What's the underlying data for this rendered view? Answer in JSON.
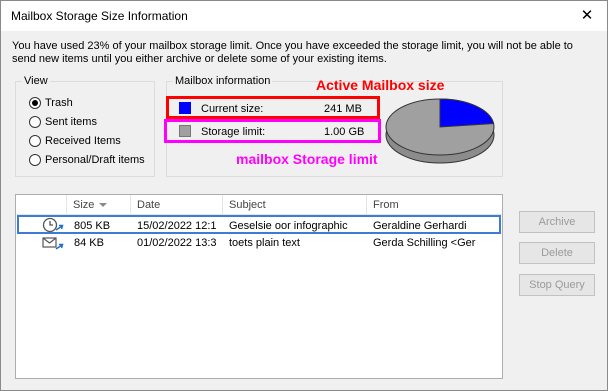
{
  "window": {
    "title": "Mailbox Storage Size Information",
    "close_glyph": "✕"
  },
  "intro_text": "You have used 23% of your mailbox storage limit.  Once you have exceeded the storage limit, you will not be able to send new items until you either archive or delete some of your existing items.",
  "view": {
    "label": "View",
    "options": [
      {
        "label": "Trash",
        "checked": true
      },
      {
        "label": "Sent items",
        "checked": false
      },
      {
        "label": "Received Items",
        "checked": false
      },
      {
        "label": "Personal/Draft items",
        "checked": false
      }
    ]
  },
  "mailbox_info": {
    "label": "Mailbox information",
    "current_size_label": "Current size:",
    "current_size_value": "241 MB",
    "current_size_color": "#0000ff",
    "storage_limit_label": "Storage limit:",
    "storage_limit_value": "1.00 GB",
    "storage_limit_color": "#a0a0a0",
    "used_fraction": 0.23
  },
  "annotations": {
    "active_text": "Active Mailbox size",
    "active_color": "#ff0000",
    "storage_text": "mailbox Storage limit",
    "storage_color": "#ff00ff"
  },
  "list": {
    "columns": [
      "Size",
      "Date",
      "Subject",
      "From"
    ],
    "rows": [
      {
        "icon": "scheduled-mail-icon",
        "size": "805 KB",
        "date": "15/02/2022 12:1",
        "subject": "Geselsie oor infographic",
        "from": "Geraldine Gerhardi"
      },
      {
        "icon": "mail-envelope-icon",
        "size": "84 KB",
        "date": "01/02/2022 13:3",
        "subject": "toets plain text",
        "from": "Gerda Schilling <Ger"
      }
    ]
  },
  "buttons": {
    "archive": "Archive",
    "delete": "Delete",
    "stop_query": "Stop Query"
  }
}
